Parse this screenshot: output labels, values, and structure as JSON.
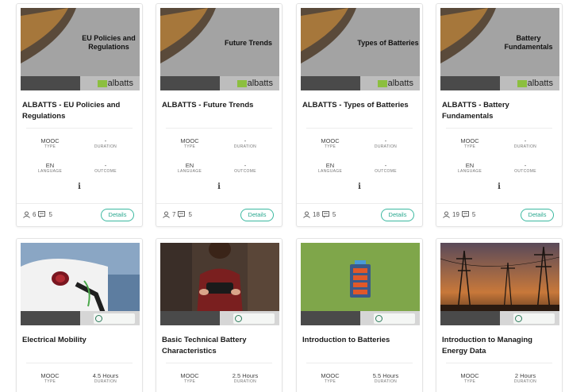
{
  "cards": [
    {
      "overlay": "EU Policies and Regulations",
      "title": "ALBATTS - EU Policies and Regulations",
      "type_value": "MOOC",
      "type_label": "TYPE",
      "duration_value": "-",
      "duration_label": "DURATION",
      "language_value": "EN",
      "language_label": "LANGUAGE",
      "outcome_value": "-",
      "outcome_label": "OUTCOME",
      "info": "i",
      "users": "6",
      "modules": "5",
      "details": "Details",
      "logo": "albatts"
    },
    {
      "overlay": "Future Trends",
      "title": "ALBATTS - Future Trends",
      "type_value": "MOOC",
      "type_label": "TYPE",
      "duration_value": "-",
      "duration_label": "DURATION",
      "language_value": "EN",
      "language_label": "LANGUAGE",
      "outcome_value": "-",
      "outcome_label": "OUTCOME",
      "info": "i",
      "users": "7",
      "modules": "5",
      "details": "Details",
      "logo": "albatts"
    },
    {
      "overlay": "Types of Batteries",
      "title": "ALBATTS - Types of Batteries",
      "type_value": "MOOC",
      "type_label": "TYPE",
      "duration_value": "-",
      "duration_label": "DURATION",
      "language_value": "EN",
      "language_label": "LANGUAGE",
      "outcome_value": "-",
      "outcome_label": "OUTCOME",
      "info": "i",
      "users": "18",
      "modules": "5",
      "details": "Details",
      "logo": "albatts"
    },
    {
      "overlay": "Battery Fundamentals",
      "title": "ALBATTS - Battery Fundamentals",
      "type_value": "MOOC",
      "type_label": "TYPE",
      "duration_value": "-",
      "duration_label": "DURATION",
      "language_value": "EN",
      "language_label": "LANGUAGE",
      "outcome_value": "-",
      "outcome_label": "OUTCOME",
      "info": "i",
      "users": "19",
      "modules": "5",
      "details": "Details",
      "logo": "albatts"
    },
    {
      "title": "Electrical Mobility",
      "type_value": "MOOC",
      "type_label": "TYPE",
      "duration_value": "4.5 Hours",
      "duration_label": "DURATION",
      "logo": "energy",
      "image": "ev-charging"
    },
    {
      "title": "Basic Technical Battery Characteristics",
      "type_value": "MOOC",
      "type_label": "TYPE",
      "duration_value": "2.5 Hours",
      "duration_label": "DURATION",
      "logo": "energy",
      "image": "presenter"
    },
    {
      "title": "Introduction to Batteries",
      "type_value": "MOOC",
      "type_label": "TYPE",
      "duration_value": "5.5 Hours",
      "duration_label": "DURATION",
      "logo": "energy",
      "image": "battery-icon"
    },
    {
      "title": "Introduction to Managing Energy Data",
      "type_value": "MOOC",
      "type_label": "TYPE",
      "duration_value": "2 Hours",
      "duration_label": "DURATION",
      "logo": "energy",
      "image": "power-lines"
    }
  ],
  "logos": {
    "albatts_text": "albatts",
    "albatts_mark": "[|]"
  },
  "colors": {
    "accent": "#2aa88f",
    "border": "#e4e4e4"
  }
}
